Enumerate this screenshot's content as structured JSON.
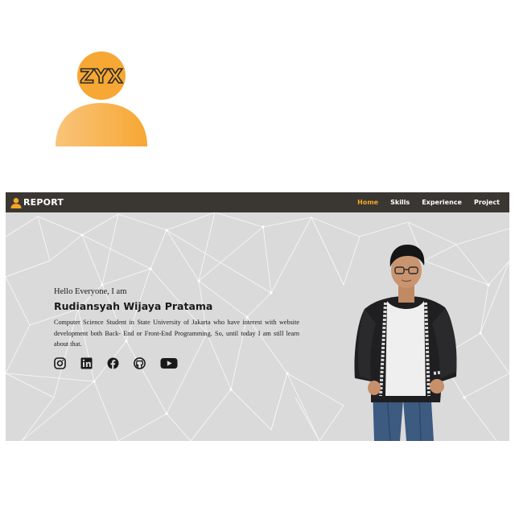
{
  "logo": {
    "text": "ZYX",
    "icon": "person-avatar-icon",
    "color": "#f7a733"
  },
  "navbar": {
    "brand_text": "REPORT",
    "brand_icon": "person-icon",
    "background": "#3a3733",
    "links": [
      {
        "label": "Home",
        "active": true
      },
      {
        "label": "Skills",
        "active": false
      },
      {
        "label": "Experience",
        "active": false
      },
      {
        "label": "Project",
        "active": false
      }
    ],
    "active_color": "#f5a623"
  },
  "hero": {
    "greeting": "Hello Everyone, I am",
    "name": "Rudiansyah Wijaya Pratama",
    "bio": "Computer Science Student in State University of Jakarta who have interest with website development both Back- End or Front-End Programming. So, until today I am still learn about that.",
    "socials": [
      {
        "icon": "instagram-icon"
      },
      {
        "icon": "linkedin-icon"
      },
      {
        "icon": "facebook-icon"
      },
      {
        "icon": "github-icon"
      },
      {
        "icon": "youtube-icon"
      }
    ],
    "portrait": "person-photo"
  }
}
